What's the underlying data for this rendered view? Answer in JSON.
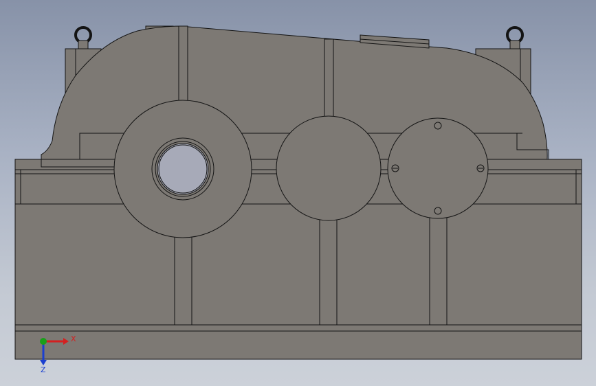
{
  "colors": {
    "background_top": "#8792a8",
    "background_bottom": "#ccd1d9",
    "housing_fill": "#7d7974",
    "edge": "#141414",
    "bore": "#a7aab8",
    "axis_x": "#d42020",
    "axis_y": "#19a019",
    "axis_z": "#1a3fd0"
  },
  "triad": {
    "x_label": "X",
    "z_label": "Z"
  }
}
